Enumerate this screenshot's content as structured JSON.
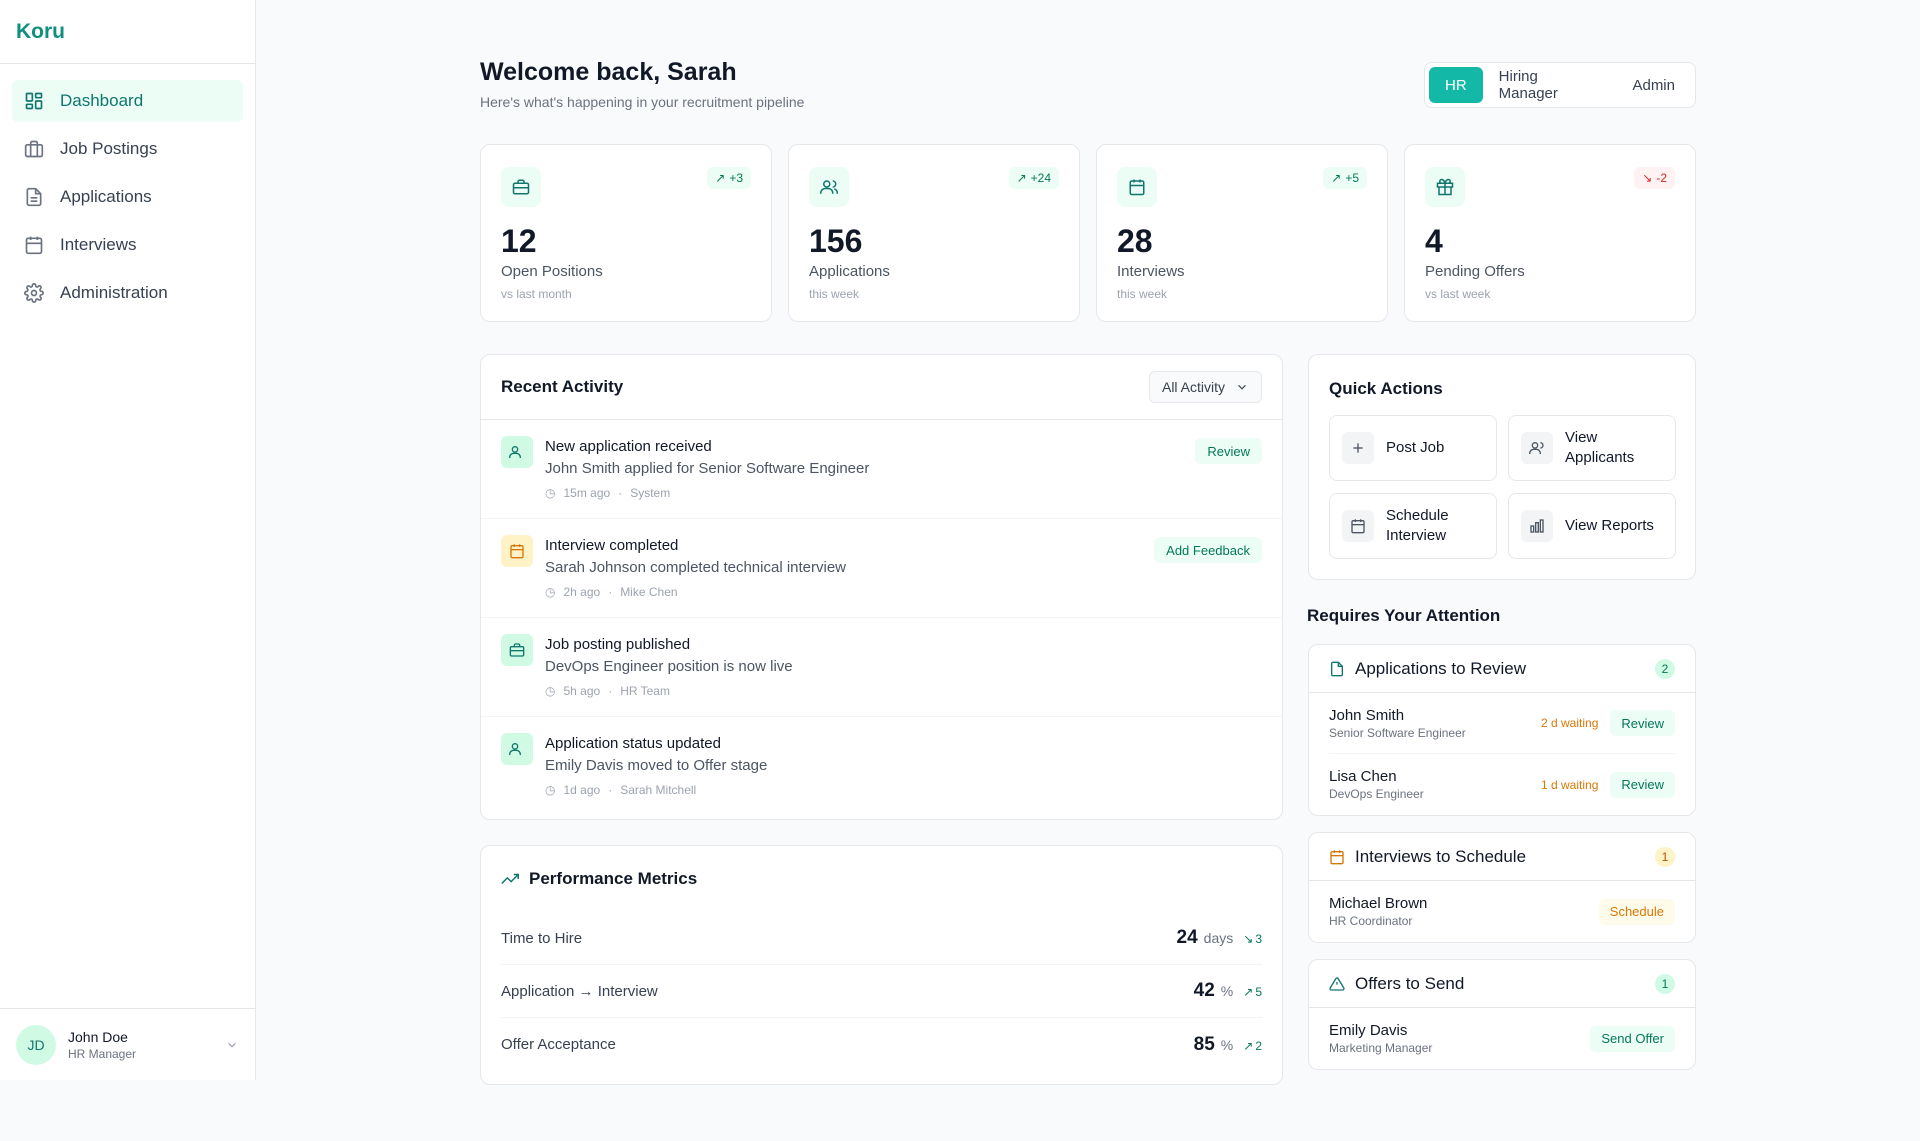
{
  "app": {
    "brand": "Koru"
  },
  "sidebar": {
    "items": [
      {
        "label": "Dashboard"
      },
      {
        "label": "Job Postings"
      },
      {
        "label": "Applications"
      },
      {
        "label": "Interviews"
      },
      {
        "label": "Administration"
      }
    ],
    "user": {
      "initials": "JD",
      "name": "John Doe",
      "role": "HR Manager"
    }
  },
  "header": {
    "title": "Welcome back, Sarah",
    "subtitle": "Here's what's happening in your recruitment pipeline",
    "roles": [
      "HR",
      "Hiring Manager",
      "Admin"
    ],
    "active_role": "HR"
  },
  "stats": [
    {
      "value": "12",
      "label": "Open Positions",
      "period": "vs last month",
      "trend": "+3",
      "trend_dir": "up",
      "icon": "briefcase-icon"
    },
    {
      "value": "156",
      "label": "Applications",
      "period": "this week",
      "trend": "+24",
      "trend_dir": "up",
      "icon": "users-icon"
    },
    {
      "value": "28",
      "label": "Interviews",
      "period": "this week",
      "trend": "+5",
      "trend_dir": "up",
      "icon": "calendar-icon"
    },
    {
      "value": "4",
      "label": "Pending Offers",
      "period": "vs last week",
      "trend": "-2",
      "trend_dir": "down",
      "icon": "gift-icon"
    }
  ],
  "activity": {
    "title": "Recent Activity",
    "filter": "All Activity",
    "items": [
      {
        "title": "New application received",
        "desc": "John Smith applied for Senior Software Engineer",
        "time": "15m ago",
        "actor": "System",
        "action": "Review",
        "icon": "user-icon"
      },
      {
        "title": "Interview completed",
        "desc": "Sarah Johnson completed technical interview",
        "time": "2h ago",
        "actor": "Mike Chen",
        "action": "Add Feedback",
        "icon": "calendar-icon"
      },
      {
        "title": "Job posting published",
        "desc": "DevOps Engineer position is now live",
        "time": "5h ago",
        "actor": "HR Team",
        "action": "",
        "icon": "briefcase-icon"
      },
      {
        "title": "Application status updated",
        "desc": "Emily Davis moved to Offer stage",
        "time": "1d ago",
        "actor": "Sarah Mitchell",
        "action": "",
        "icon": "user-icon"
      }
    ]
  },
  "performance": {
    "title": "Performance Metrics",
    "metrics": [
      {
        "label": "Time to Hire",
        "value": "24",
        "unit": "days",
        "trend": "3",
        "trend_dir": "down"
      },
      {
        "label": "Application → Interview",
        "value": "42",
        "unit": "%",
        "trend": "5",
        "trend_dir": "up"
      },
      {
        "label": "Offer Acceptance",
        "value": "85",
        "unit": "%",
        "trend": "2",
        "trend_dir": "up"
      }
    ]
  },
  "quick_actions": {
    "title": "Quick Actions",
    "items": [
      {
        "label": "Post Job",
        "icon": "plus-icon"
      },
      {
        "label": "View Applicants",
        "icon": "users-icon"
      },
      {
        "label": "Schedule Interview",
        "icon": "calendar-icon"
      },
      {
        "label": "View Reports",
        "icon": "bar-chart-icon"
      }
    ]
  },
  "attention": {
    "title": "Requires Your Attention",
    "groups": [
      {
        "title": "Applications to Review",
        "count": "2",
        "rows": [
          {
            "name": "John Smith",
            "sub": "Senior Software Engineer",
            "waiting": "2 d waiting",
            "action": "Review"
          },
          {
            "name": "Lisa Chen",
            "sub": "DevOps Engineer",
            "waiting": "1 d waiting",
            "action": "Review"
          }
        ]
      },
      {
        "title": "Interviews to Schedule",
        "count": "1",
        "rows": [
          {
            "name": "Michael Brown",
            "sub": "HR Coordinator",
            "waiting": "",
            "action": "Schedule"
          }
        ]
      },
      {
        "title": "Offers to Send",
        "count": "1",
        "rows": [
          {
            "name": "Emily Davis",
            "sub": "Marketing Manager",
            "waiting": "",
            "action": "Send Offer"
          }
        ]
      }
    ]
  },
  "colors": {
    "accent": "#14b8a6",
    "accent_dark": "#0f766e",
    "warning": "#d97706",
    "danger": "#dc2626"
  }
}
